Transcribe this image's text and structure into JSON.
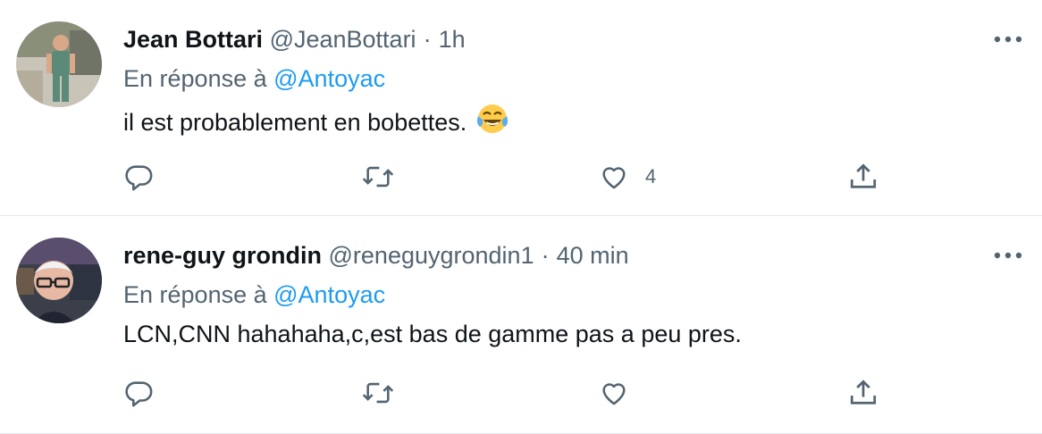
{
  "tweets": [
    {
      "name": "Jean Bottari",
      "handle": "@JeanBottari",
      "separator": "·",
      "time": "1h",
      "reply_prefix": "En réponse à",
      "reply_to": "@Antoyac",
      "text": "il est probablement en bobettes.",
      "emoji": "face-with-tears-of-joy",
      "like_count": "4",
      "icons": [
        "reply-icon",
        "retweet-icon",
        "like-icon",
        "share-icon",
        "more-icon"
      ]
    },
    {
      "name": "rene-guy grondin",
      "handle": "@reneguygrondin1",
      "separator": "·",
      "time": "40 min",
      "reply_prefix": "En réponse à",
      "reply_to": "@Antoyac",
      "text": "LCN,CNN hahahaha,c,est bas de gamme pas a peu pres.",
      "like_count": "",
      "icons": [
        "reply-icon",
        "retweet-icon",
        "like-icon",
        "share-icon",
        "more-icon"
      ]
    }
  ],
  "colors": {
    "text": "#0f1419",
    "secondary": "#536471",
    "link": "#1d9bf0",
    "divider": "#e1e8ed"
  }
}
